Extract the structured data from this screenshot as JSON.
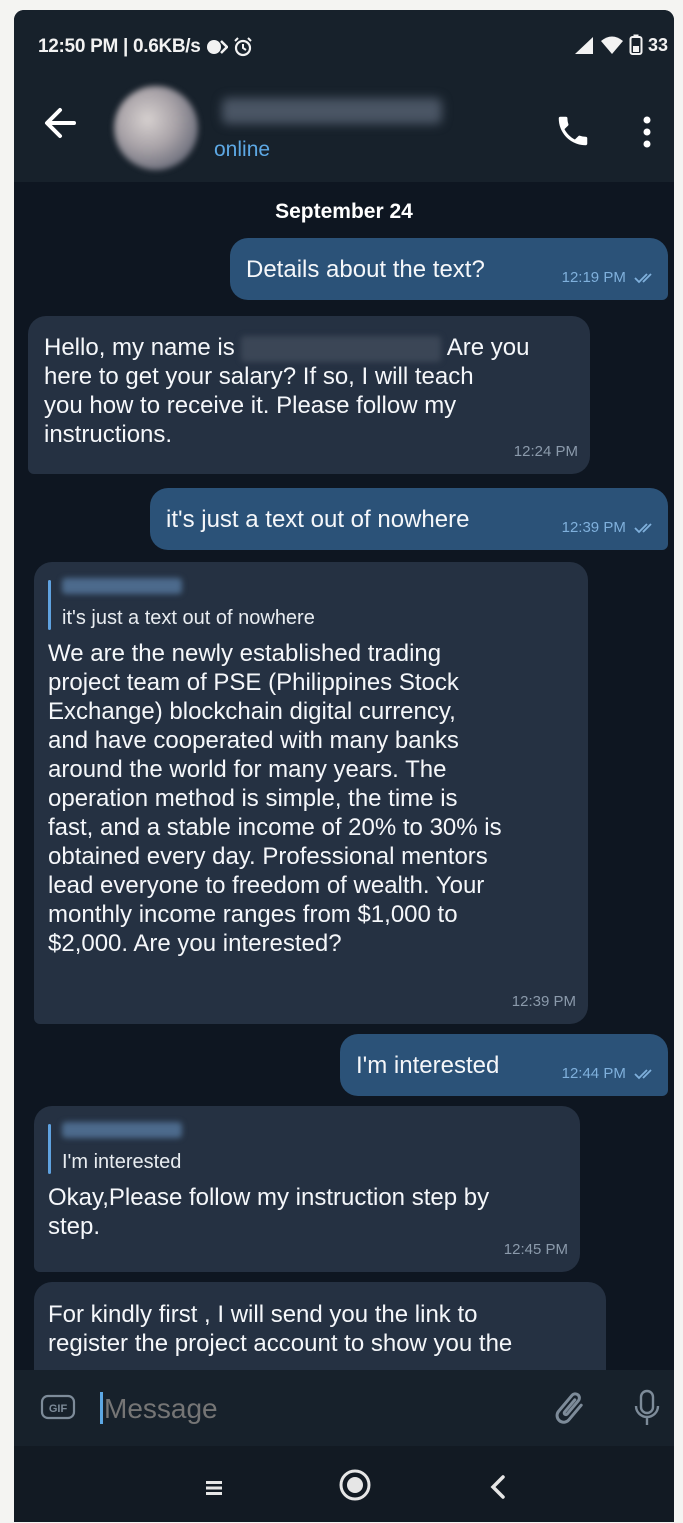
{
  "status_bar": {
    "time_speed": "12:50 PM | 0.6KB/s",
    "battery": "33"
  },
  "header": {
    "status": "online"
  },
  "chat": {
    "date_separator": "September 24",
    "messages": [
      {
        "dir": "out",
        "text": "Details about the text?",
        "time": "12:19 PM"
      },
      {
        "dir": "in",
        "text_before": "Hello, my name is",
        "text_after": "Are you",
        "text_rest": "here to get your salary? If so, I will teach\nyou how to receive it. Please follow my\ninstructions.",
        "time": "12:24 PM"
      },
      {
        "dir": "out",
        "text": "it's just a text out of nowhere",
        "time": "12:39 PM"
      },
      {
        "dir": "in",
        "reply_to": "it's just a text out of nowhere",
        "text": "We are the newly established trading\nproject team of PSE (Philippines Stock\nExchange) blockchain digital currency,\nand have cooperated with many banks\naround the world for many years. The\noperation method is simple, the time is\nfast, and a stable income of 20% to 30% is\nobtained every day. Professional mentors\nlead everyone to freedom of wealth. Your\nmonthly income ranges from $1,000 to\n$2,000. Are you interested?",
        "time": "12:39 PM"
      },
      {
        "dir": "out",
        "text": "I'm interested",
        "time": "12:44 PM"
      },
      {
        "dir": "in",
        "reply_to": "I'm interested",
        "text": "Okay,Please follow my instruction step by\nstep.",
        "time": "12:45 PM"
      },
      {
        "dir": "in",
        "text": "For kindly first , I will send you the link to\nregister the project account to show you the"
      }
    ]
  },
  "composer": {
    "placeholder": "Message",
    "gif_label": "GIF"
  },
  "colors": {
    "chat_bg": "#0e1621",
    "bubble_out": "#2b5278",
    "bubble_in": "#253142",
    "accent": "#5da8e4"
  }
}
